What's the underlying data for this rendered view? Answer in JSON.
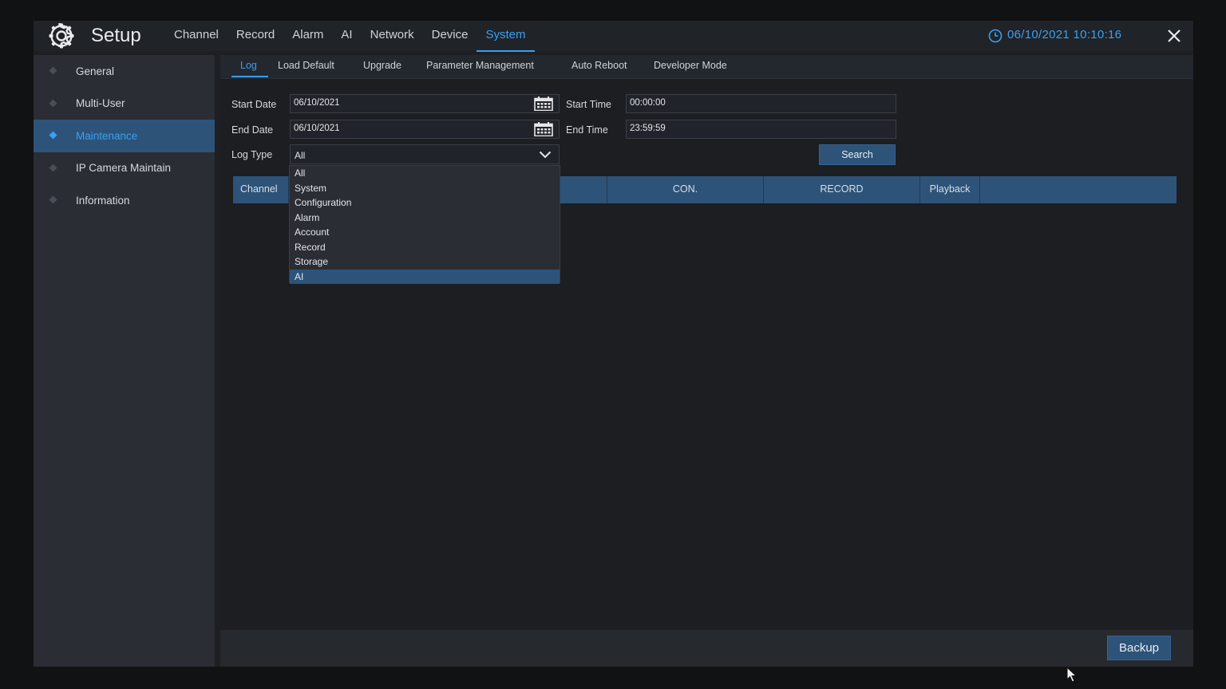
{
  "header": {
    "title": "Setup",
    "datetime": "06/10/2021 10:10:16",
    "nav": [
      {
        "label": "Channel",
        "active": false
      },
      {
        "label": "Record",
        "active": false
      },
      {
        "label": "Alarm",
        "active": false
      },
      {
        "label": "AI",
        "active": false
      },
      {
        "label": "Network",
        "active": false
      },
      {
        "label": "Device",
        "active": false
      },
      {
        "label": "System",
        "active": true
      }
    ]
  },
  "sidebar": {
    "items": [
      {
        "label": "General",
        "active": false
      },
      {
        "label": "Multi-User",
        "active": false
      },
      {
        "label": "Maintenance",
        "active": true
      },
      {
        "label": "IP Camera Maintain",
        "active": false
      },
      {
        "label": "Information",
        "active": false
      }
    ]
  },
  "subtabs": [
    {
      "label": "Log",
      "active": true
    },
    {
      "label": "Load Default",
      "active": false
    },
    {
      "label": "Upgrade",
      "active": false
    },
    {
      "label": "Parameter Management",
      "active": false
    },
    {
      "label": "Auto Reboot",
      "active": false
    },
    {
      "label": "Developer Mode",
      "active": false
    }
  ],
  "form": {
    "start_date_label": "Start Date",
    "start_date_value": "06/10/2021",
    "end_date_label": "End Date",
    "end_date_value": "06/10/2021",
    "start_time_label": "Start Time",
    "start_time_value": "00:00:00",
    "end_time_label": "End Time",
    "end_time_value": "23:59:59",
    "log_type_label": "Log Type",
    "log_type_value": "All",
    "search_label": "Search"
  },
  "dropdown": {
    "options": [
      "All",
      "System",
      "Configuration",
      "Alarm",
      "Account",
      "Record",
      "Storage",
      "AI"
    ],
    "highlighted": "AI"
  },
  "table": {
    "columns": [
      "Channel",
      "",
      "CON.",
      "RECORD",
      "Playback",
      ""
    ]
  },
  "footer": {
    "backup_label": "Backup"
  },
  "colors": {
    "accent": "#3aa0f0",
    "selection": "#2d5379"
  }
}
